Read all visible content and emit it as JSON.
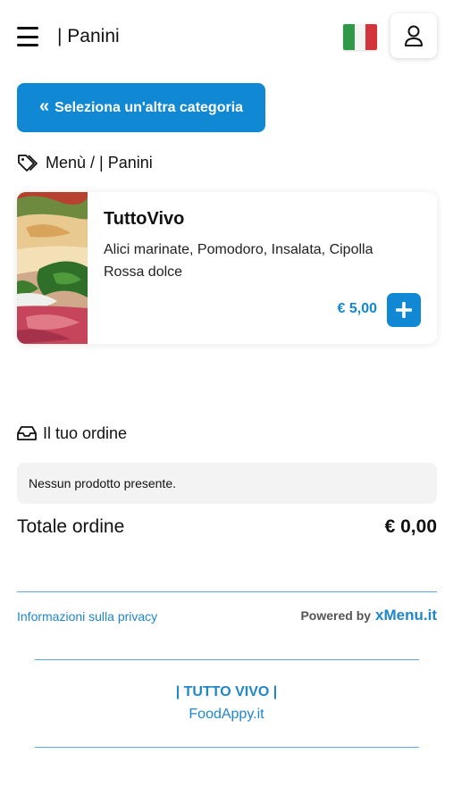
{
  "header": {
    "title": "| Panini",
    "menu_icon": "hamburger-menu-icon",
    "language_flag": "italian-flag",
    "user_icon": "user-icon"
  },
  "category_button": {
    "label": "Seleziona un'altra categoria",
    "icon": "double-chevron-left-icon"
  },
  "breadcrumb": {
    "icon": "tags-icon",
    "text": "Menù / | Panini"
  },
  "products": [
    {
      "name": "TuttoVivo",
      "description": "Alici marinate, Pomodoro, Insalata, Cipolla Rossa dolce",
      "price": "€ 5,00",
      "add_icon": "plus-icon"
    }
  ],
  "order": {
    "icon": "inbox-icon",
    "title": "Il tuo ordine",
    "empty_message": "Nessun prodotto presente.",
    "total_label": "Totale ordine",
    "total_value": "€ 0,00"
  },
  "footer": {
    "privacy_link": "Informazioni sulla privacy",
    "powered_by": "Powered by",
    "powered_brand": "xMenu.it",
    "restaurant_name": "| TUTTO VIVO |",
    "site": "FoodAppy.it"
  },
  "colors": {
    "accent": "#1188d3",
    "link": "#1f86c9",
    "divider": "#5aa9e6"
  }
}
